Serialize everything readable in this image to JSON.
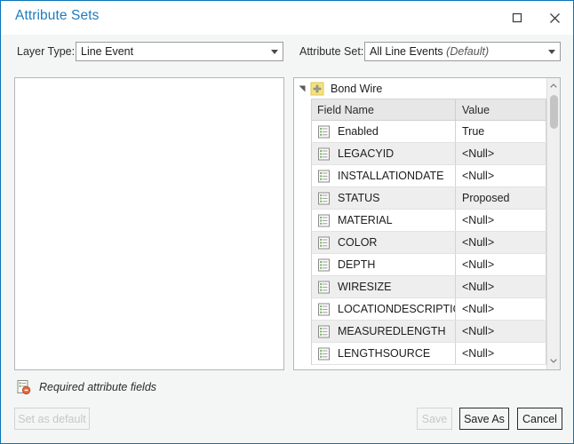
{
  "window": {
    "title": "Attribute Sets",
    "accent_color": "#0a74b8",
    "title_color": "#1f7bbf",
    "controls": {
      "maximize": "maximize-icon",
      "close": "close-icon"
    }
  },
  "selectors": {
    "layer_type": {
      "label": "Layer Type:",
      "value": "Line Event"
    },
    "attribute_set": {
      "label": "Attribute Set:",
      "value": "All Line Events ",
      "value_suffix": "(Default)"
    }
  },
  "tree": {
    "layer_name": "Bond Wire",
    "layer_icon": "line-event-layer-icon",
    "expanded": true
  },
  "grid": {
    "columns": [
      "Field Name",
      "Value"
    ],
    "rows": [
      {
        "field": "Enabled",
        "value": "True"
      },
      {
        "field": "LEGACYID",
        "value": "<Null>"
      },
      {
        "field": "INSTALLATIONDATE",
        "value": "<Null>"
      },
      {
        "field": "STATUS",
        "value": "Proposed"
      },
      {
        "field": "MATERIAL",
        "value": "<Null>"
      },
      {
        "field": "COLOR",
        "value": "<Null>"
      },
      {
        "field": "DEPTH",
        "value": "<Null>"
      },
      {
        "field": "WIRESIZE",
        "value": "<Null>"
      },
      {
        "field": "LOCATIONDESCRIPTION",
        "value": "<Null>"
      },
      {
        "field": "MEASUREDLENGTH",
        "value": "<Null>"
      },
      {
        "field": "LENGTHSOURCE",
        "value": "<Null>"
      }
    ]
  },
  "legend": {
    "icon": "required-attribute-fields-icon",
    "text": "Required attribute fields"
  },
  "buttons": {
    "set_as_default": "Set as default",
    "save": "Save",
    "save_as": "Save As",
    "cancel": "Cancel"
  }
}
